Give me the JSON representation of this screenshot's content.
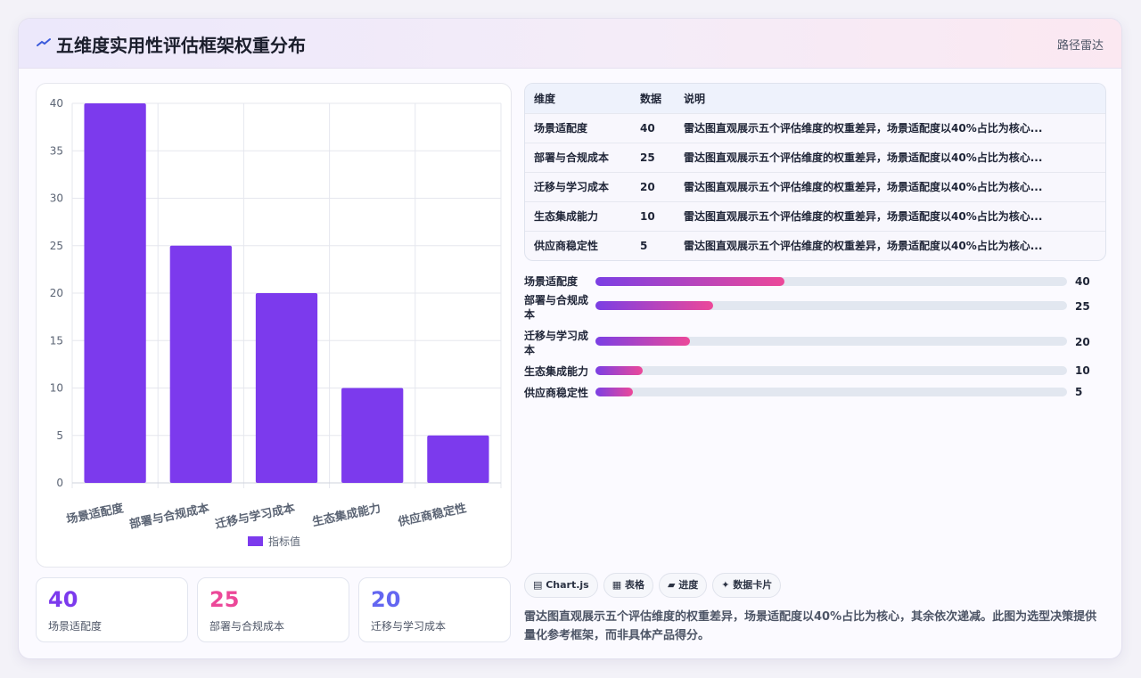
{
  "header": {
    "icon": "line-icon",
    "title": "五维度实用性评估框架权重分布",
    "tag": "路径雷达"
  },
  "chart_data": {
    "type": "bar",
    "categories": [
      "场景适配度",
      "部署与合规成本",
      "迁移与学习成本",
      "生态集成能力",
      "供应商稳定性"
    ],
    "series": [
      {
        "name": "指标值",
        "values": [
          40,
          25,
          20,
          10,
          5
        ],
        "color": "#7c3aed"
      }
    ],
    "ylim": [
      0,
      40
    ],
    "yticks": [
      0,
      5,
      10,
      15,
      20,
      25,
      30,
      35,
      40
    ],
    "grid": true,
    "legend": "bottom"
  },
  "stats": [
    {
      "value": "40",
      "label": "场景适配度",
      "color": "#7c3aed"
    },
    {
      "value": "25",
      "label": "部署与合规成本",
      "color": "#ec4899"
    },
    {
      "value": "20",
      "label": "迁移与学习成本",
      "color": "#6366f1"
    }
  ],
  "table": {
    "headers": [
      "维度",
      "数据",
      "说明"
    ],
    "rows": [
      [
        "场景适配度",
        "40",
        "雷达图直观展示五个评估维度的权重差异，场景适配度以40%占比为核心..."
      ],
      [
        "部署与合规成本",
        "25",
        "雷达图直观展示五个评估维度的权重差异，场景适配度以40%占比为核心..."
      ],
      [
        "迁移与学习成本",
        "20",
        "雷达图直观展示五个评估维度的权重差异，场景适配度以40%占比为核心..."
      ],
      [
        "生态集成能力",
        "10",
        "雷达图直观展示五个评估维度的权重差异，场景适配度以40%占比为核心..."
      ],
      [
        "供应商稳定性",
        "5",
        "雷达图直观展示五个评估维度的权重差异，场景适配度以40%占比为核心..."
      ]
    ]
  },
  "progress": [
    {
      "label": "场景适配度",
      "value": "40",
      "fraction": 0.4
    },
    {
      "label": "部署与合规成本",
      "value": "25",
      "fraction": 0.25
    },
    {
      "label": "迁移与学习成本",
      "value": "20",
      "fraction": 0.2
    },
    {
      "label": "生态集成能力",
      "value": "10",
      "fraction": 0.1
    },
    {
      "label": "供应商稳定性",
      "value": "5",
      "fraction": 0.08
    }
  ],
  "chips": [
    "▤ Chart.js",
    "▦ 表格",
    "▰ 进度",
    "✦ 数据卡片"
  ],
  "description": "雷达图直观展示五个评估维度的权重差异，场景适配度以40%占比为核心，其余依次递减。此图为选型决策提供量化参考框架，而非具体产品得分。"
}
